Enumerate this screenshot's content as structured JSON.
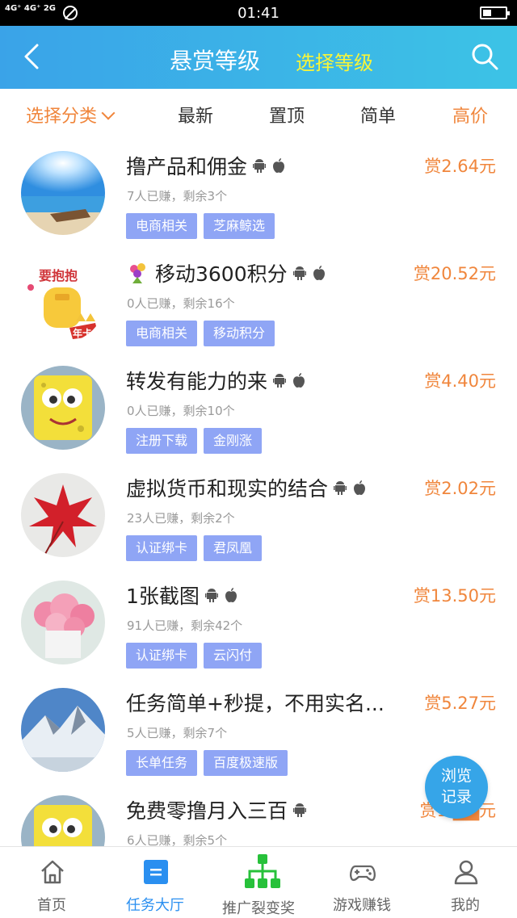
{
  "status_bar": {
    "signal": "4G⁺ 4G⁺ 2G",
    "time": "01:41"
  },
  "header": {
    "title": "悬赏等级",
    "subtitle": "选择等级"
  },
  "filter": {
    "category_label": "选择分类",
    "tabs": [
      "最新",
      "置顶",
      "简单",
      "高价"
    ]
  },
  "tasks": [
    {
      "title": "撸产品和佣金",
      "reward": "赏2.64元",
      "meta": "7人已赚，剩余3个",
      "tags": [
        "电商相关",
        "芝麻鲸选"
      ],
      "avatar": "sea-boat"
    },
    {
      "title": "移动3600积分",
      "title_prefix_icon": "flower-emoji-icon",
      "reward": "赏20.52元",
      "meta": "0人已赚，剩余16个",
      "tags": [
        "电商相关",
        "移动积分"
      ],
      "avatar": "red-packet",
      "avatar_text": "要抱抱",
      "avatar_badge": "年卡"
    },
    {
      "title": "转发有能力的来",
      "reward": "赏4.40元",
      "meta": "0人已赚，剩余10个",
      "tags": [
        "注册下载",
        "金刚涨"
      ],
      "avatar": "sponge-cartoon"
    },
    {
      "title": "虚拟货币和现实的结合",
      "reward": "赏2.02元",
      "meta": "23人已赚，剩余2个",
      "tags": [
        "认证绑卡",
        "君凤凰"
      ],
      "avatar": "red-maple-leaf"
    },
    {
      "title": "1张截图",
      "reward": "赏13.50元",
      "meta": "91人已赚，剩余42个",
      "tags": [
        "认证绑卡",
        "云闪付"
      ],
      "avatar": "pink-flowers"
    },
    {
      "title": "任务简单+秒提，不用实名...",
      "reward": "赏5.27元",
      "meta": "5人已赚，剩余7个",
      "tags": [
        "长单任务",
        "百度极速版"
      ],
      "avatar": "snow-mountain"
    },
    {
      "title": "免费零撸月入三百",
      "reward": "赏1.██元",
      "meta": "6人已赚，剩余5个",
      "tags": [],
      "avatar": "sponge-cartoon"
    }
  ],
  "float_button": {
    "line1": "浏览",
    "line2": "记录"
  },
  "nav": [
    {
      "label": "首页",
      "icon": "home-icon",
      "active": false
    },
    {
      "label": "任务大厅",
      "icon": "task-hall-icon",
      "active": true
    },
    {
      "label": "推广裂变奖",
      "icon": "share-tree-icon",
      "active": false
    },
    {
      "label": "游戏赚钱",
      "icon": "gamepad-icon",
      "active": false
    },
    {
      "label": "我的",
      "icon": "user-icon",
      "active": false
    }
  ],
  "colors": {
    "header_start": "#3aa3e8",
    "header_end": "#3cc3e6",
    "accent_orange": "#f0863c",
    "tag_bg": "#8fa5f5",
    "nav_active": "#2a8ff0",
    "subtitle_yellow": "#f7f53a"
  }
}
